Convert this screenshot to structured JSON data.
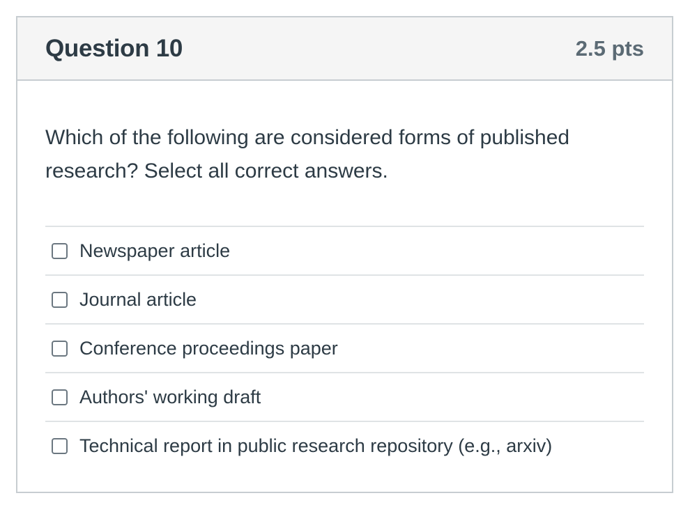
{
  "question": {
    "title": "Question 10",
    "points": "2.5 pts",
    "text": "Which of the following are considered forms of published research? Select all correct answers."
  },
  "answers": [
    {
      "label": "Newspaper article",
      "checked": false
    },
    {
      "label": "Journal article",
      "checked": false
    },
    {
      "label": "Conference proceedings paper",
      "checked": false
    },
    {
      "label": "Authors' working draft",
      "checked": false
    },
    {
      "label": "Technical report in public research repository (e.g., arxiv)",
      "checked": false
    }
  ],
  "colors": {
    "header_bg": "#f5f5f5",
    "border": "#c7cdd1",
    "text": "#2d3b45",
    "points_text": "#5b6a74"
  }
}
